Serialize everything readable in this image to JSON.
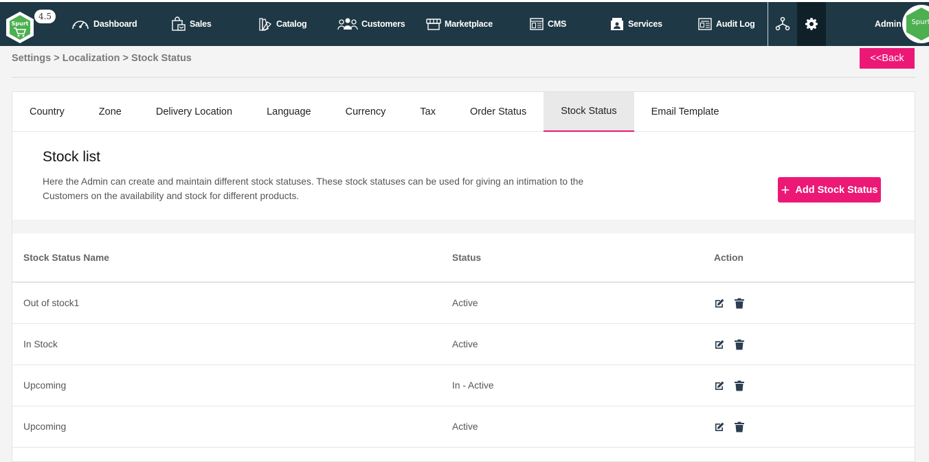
{
  "app": {
    "version": "4.5",
    "logo_alt": "Spurt",
    "colors": {
      "nav_bg": "#1f3845",
      "accent": "#ec1876"
    }
  },
  "nav": {
    "items": [
      {
        "label": "Dashboard",
        "icon": "speedometer-icon"
      },
      {
        "label": "Sales",
        "icon": "shopping-bag-icon"
      },
      {
        "label": "Catalog",
        "icon": "catalog-swatch-icon"
      },
      {
        "label": "Customers",
        "icon": "users-icon"
      },
      {
        "label": "Marketplace",
        "icon": "storefront-icon"
      },
      {
        "label": "CMS",
        "icon": "cms-layout-icon"
      },
      {
        "label": "Services",
        "icon": "services-icon"
      },
      {
        "label": "Audit Log",
        "icon": "audit-log-icon"
      }
    ],
    "admin": "Admin"
  },
  "breadcrumb": "Settings > Localization > Stock Status",
  "back_label": "<<Back",
  "tabs": [
    {
      "label": "Country"
    },
    {
      "label": "Zone"
    },
    {
      "label": "Delivery Location"
    },
    {
      "label": "Language"
    },
    {
      "label": "Currency"
    },
    {
      "label": "Tax"
    },
    {
      "label": "Order Status"
    },
    {
      "label": "Stock Status",
      "active": true
    },
    {
      "label": "Email Template"
    }
  ],
  "section": {
    "title": "Stock list",
    "description": "Here the Admin can create and maintain different stock statuses. These stock statuses can be used for giving an intimation to the Customers on the availability and stock for different products.",
    "add_label": "Add Stock Status"
  },
  "table": {
    "headers": {
      "name": "Stock Status Name",
      "status": "Status",
      "action": "Action"
    },
    "rows": [
      {
        "name": "Out of stock1",
        "status": "Active"
      },
      {
        "name": "In Stock",
        "status": "Active"
      },
      {
        "name": "Upcoming",
        "status": "In - Active"
      },
      {
        "name": "Upcoming",
        "status": "Active"
      }
    ]
  }
}
